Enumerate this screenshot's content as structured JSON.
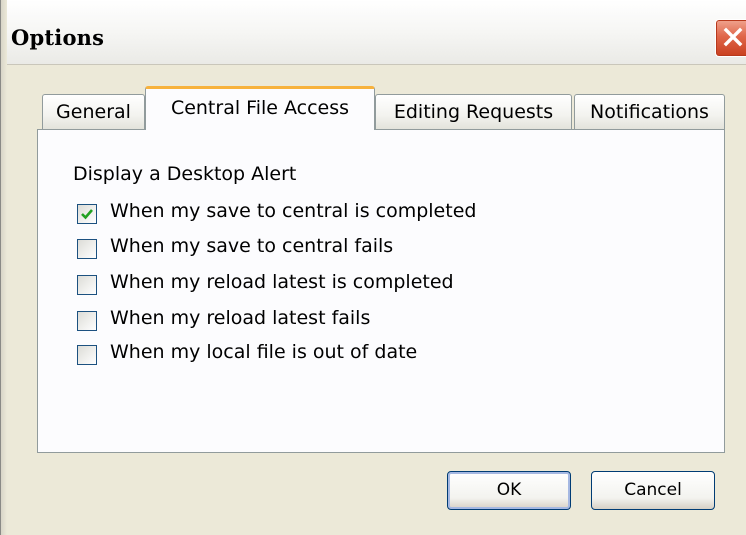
{
  "window": {
    "title": "Options",
    "close_icon": "close-icon"
  },
  "tabs": [
    {
      "label": "General",
      "active": false
    },
    {
      "label": "Central File Access",
      "active": true
    },
    {
      "label": "Editing Requests",
      "active": false
    },
    {
      "label": "Notifications",
      "active": false
    }
  ],
  "panel": {
    "group_label": "Display a Desktop Alert",
    "options": [
      {
        "label": "When my save to central is completed",
        "checked": true
      },
      {
        "label": "When my save to central fails",
        "checked": false
      },
      {
        "label": "When my reload latest is completed",
        "checked": false
      },
      {
        "label": "When my reload latest fails",
        "checked": false
      },
      {
        "label": "When my local file is out of date",
        "checked": false
      }
    ]
  },
  "buttons": {
    "ok": "OK",
    "cancel": "Cancel"
  },
  "colors": {
    "dialog_bg": "#ece9d8",
    "close_red": "#e0664a",
    "active_tab_accent": "#f7b23d",
    "checkmark": "#21a121"
  }
}
